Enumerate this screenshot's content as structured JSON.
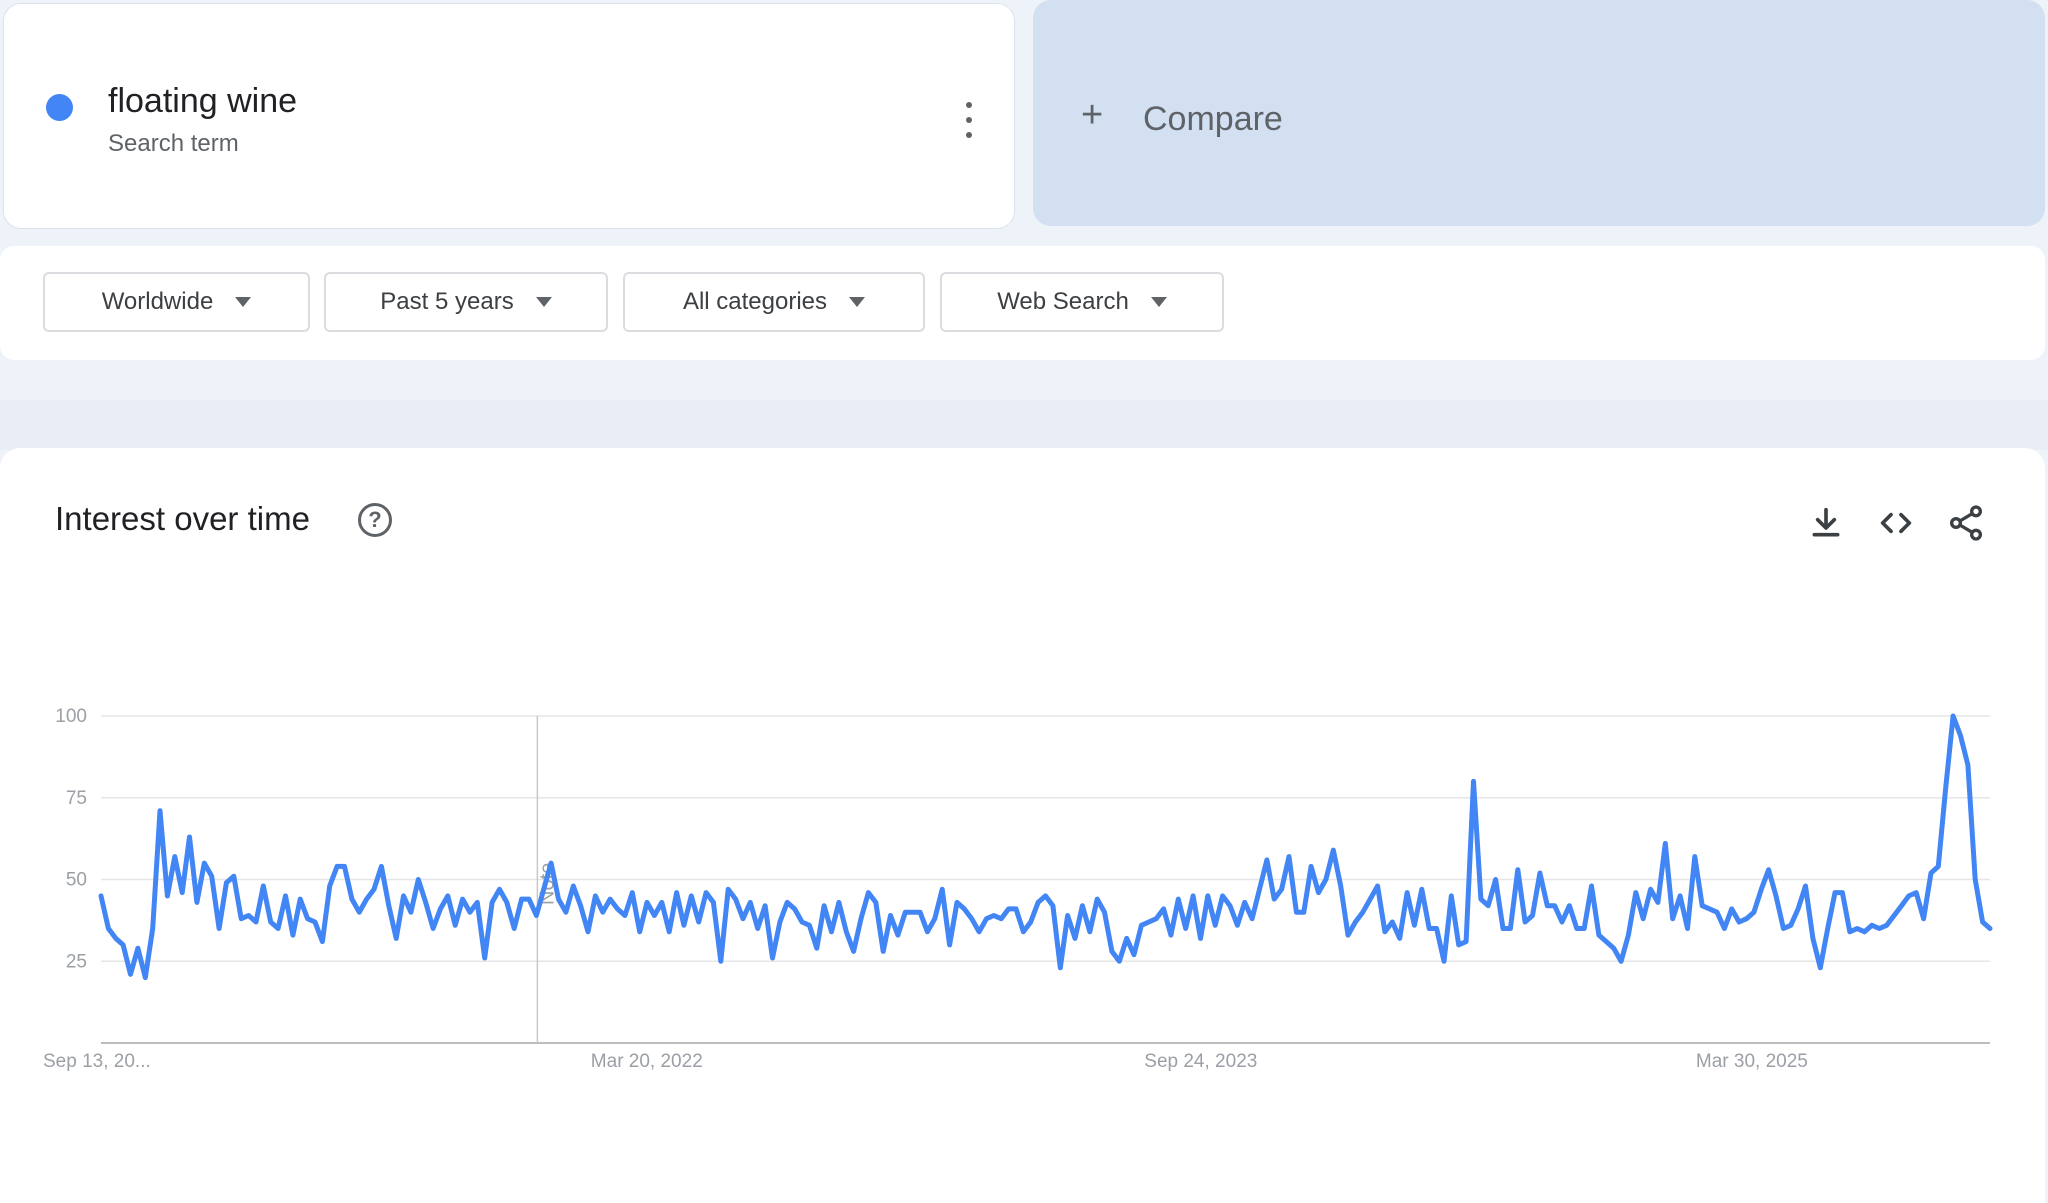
{
  "search_term": {
    "name": "floating wine",
    "subtitle": "Search term",
    "color": "#4285f4"
  },
  "compare": {
    "label": "Compare",
    "plus": "+"
  },
  "filters": [
    {
      "label": "Worldwide"
    },
    {
      "label": "Past 5 years"
    },
    {
      "label": "All categories"
    },
    {
      "label": "Web Search"
    }
  ],
  "interest": {
    "title": "Interest over time",
    "help_glyph": "?",
    "icons": [
      "download-icon",
      "embed-code-icon",
      "share-icon"
    ]
  },
  "chart_data": {
    "type": "line",
    "title": "",
    "xlabel": "",
    "ylabel": "",
    "ylim": [
      0,
      100
    ],
    "yticks": [
      25,
      50,
      75,
      100
    ],
    "xtick_labels": [
      "Sep 13, 20...",
      "Mar 20, 2022",
      "Sep 24, 2023",
      "Mar 30, 2025"
    ],
    "note_label": "Note",
    "grid": true,
    "line_color": "#4285f4",
    "series": [
      {
        "values": [
          45,
          35,
          32,
          30,
          21,
          29,
          20,
          35,
          71,
          45,
          57,
          46,
          63,
          43,
          55,
          51,
          35,
          49,
          51,
          38,
          39,
          37,
          48,
          37,
          35,
          45,
          33,
          44,
          38,
          37,
          31,
          48,
          54,
          54,
          44,
          40,
          44,
          47,
          54,
          42,
          32,
          45,
          40,
          50,
          43,
          35,
          41,
          45,
          36,
          44,
          40,
          43,
          26,
          43,
          47,
          43,
          35,
          44,
          44,
          39,
          47,
          55,
          44,
          40,
          48,
          42,
          34,
          45,
          40,
          44,
          41,
          39,
          46,
          34,
          43,
          39,
          43,
          34,
          46,
          36,
          45,
          37,
          46,
          43,
          25,
          47,
          44,
          38,
          43,
          35,
          42,
          26,
          37,
          43,
          41,
          37,
          36,
          29,
          42,
          34,
          43,
          34,
          28,
          38,
          46,
          43,
          28,
          39,
          33,
          40,
          40,
          40,
          34,
          38,
          47,
          30,
          43,
          41,
          38,
          34,
          38,
          39,
          38,
          41,
          41,
          34,
          37,
          43,
          45,
          42,
          23,
          39,
          32,
          42,
          34,
          44,
          40,
          28,
          25,
          32,
          27,
          36,
          37,
          38,
          41,
          33,
          44,
          35,
          45,
          32,
          45,
          36,
          45,
          42,
          36,
          43,
          38,
          47,
          56,
          44,
          47,
          57,
          40,
          40,
          54,
          46,
          50,
          59,
          48,
          33,
          37,
          40,
          44,
          48,
          34,
          37,
          32,
          46,
          36,
          47,
          35,
          35,
          25,
          45,
          30,
          31,
          80,
          44,
          42,
          50,
          35,
          35,
          53,
          37,
          39,
          52,
          42,
          42,
          37,
          42,
          35,
          35,
          48,
          33,
          31,
          29,
          25,
          33,
          46,
          38,
          47,
          43,
          61,
          38,
          45,
          35,
          57,
          42,
          41,
          40,
          35,
          41,
          37,
          38,
          40,
          47,
          53,
          45,
          35,
          36,
          41,
          48,
          32,
          23,
          35,
          46,
          46,
          34,
          35,
          34,
          36,
          35,
          36,
          39,
          42,
          45,
          46,
          38,
          52,
          54,
          78,
          100,
          94,
          85,
          50,
          37,
          35
        ]
      }
    ]
  }
}
